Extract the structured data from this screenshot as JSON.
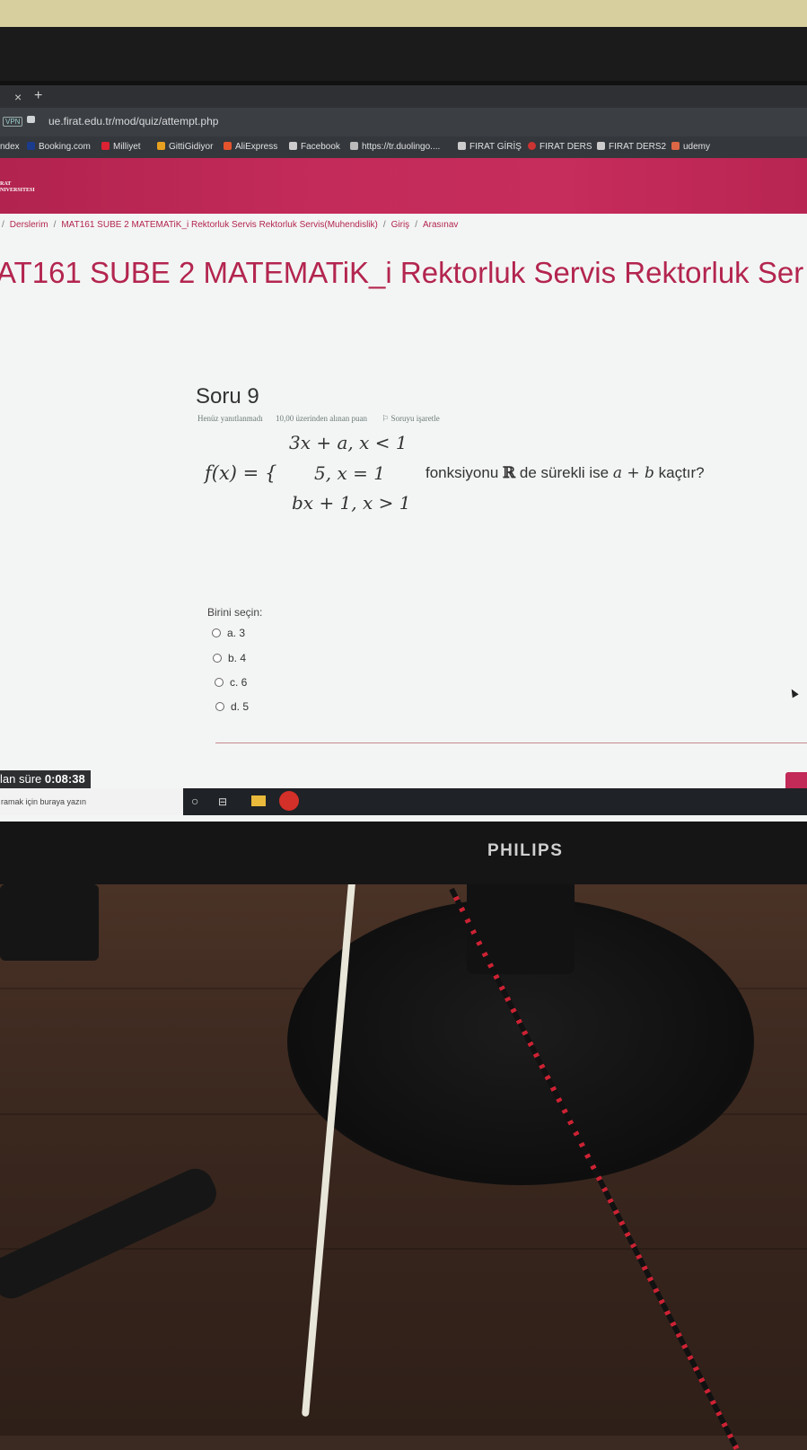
{
  "browser": {
    "tab_close": "×",
    "tab_new": "+",
    "vpn": "VPN",
    "url": "ue.firat.edu.tr/mod/quiz/attempt.php",
    "bookmarks": [
      "ndex",
      "Booking.com",
      "Milliyet",
      "GittiGidiyor",
      "AliExpress",
      "Facebook",
      "https://tr.duolingo....",
      "FIRAT GİRİŞ",
      "FIRAT DERS",
      "FIRAT DERS2",
      "udemy"
    ]
  },
  "site": {
    "logo_line1": "RAT",
    "logo_line2": "NIVERSITESI",
    "breadcrumb": [
      "Derslerim",
      "MAT161 SUBE 2 MATEMATiK_i Rektorluk Servis Rektorluk Servis(Muhendislik)",
      "Giriş",
      "Arasınav"
    ],
    "course_title": "AT161 SUBE 2 MATEMATiK_i Rektorluk Servis Rektorluk Ser"
  },
  "question": {
    "number": "Soru 9",
    "status": "Henüz yanıtlanmadı",
    "points": "10,00 üzerinden alınan puan",
    "flag": "Soruyu işaretle",
    "fx": "f(x) = {",
    "case1": "3x + a,  x < 1",
    "case2": "5,  x = 1",
    "case3": "bx + 1,  x > 1",
    "text_before": "fonksiyonu ",
    "text_R": "ℝ",
    "text_mid": " de sürekli ise ",
    "text_expr": "a + b",
    "text_after": " kaçtır?",
    "choose_label": "Birini seçin:",
    "options": [
      "a. 3",
      "b. 4",
      "c. 6",
      "d. 5"
    ]
  },
  "timer": {
    "label": "lan süre",
    "value": "0:08:38"
  },
  "taskbar": {
    "search_placeholder": "ramak için buraya yazın"
  },
  "monitor": {
    "brand": "PHILIPS"
  }
}
